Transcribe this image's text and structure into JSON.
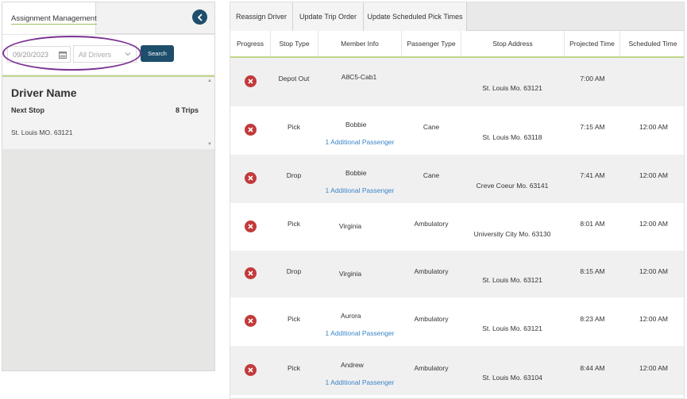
{
  "left_panel": {
    "tab_label": "Assignment Management",
    "filters": {
      "date": "09/20/2023",
      "driver": "All Drivers",
      "search_label": "Search"
    },
    "driver_card": {
      "name": "Driver Name",
      "next_stop_label": "Next Stop",
      "trips": "8 Trips",
      "address": "St. Louis MO. 63121"
    }
  },
  "toolbar": {
    "tabs": [
      "Reassign Driver",
      "Update Trip Order",
      "Update Scheduled Pick Times"
    ]
  },
  "table": {
    "columns": [
      "Progress",
      "Stop Type",
      "Member Info",
      "Passenger Type",
      "Stop Address",
      "Projected Time",
      "Scheduled Time"
    ],
    "rows": [
      {
        "stop_type": "Depot Out",
        "member": "A8C5-Cab1",
        "extra": "",
        "passenger_type": "",
        "address": "St. Louis Mo. 63121",
        "projected": "7:00 AM",
        "scheduled": ""
      },
      {
        "stop_type": "Pick",
        "member": "Bobbie",
        "extra": "1 Additional Passenger",
        "passenger_type": "Cane",
        "address": "St. Louis Mo. 63118",
        "projected": "7:15 AM",
        "scheduled": "12:00 AM"
      },
      {
        "stop_type": "Drop",
        "member": "Bobbie",
        "extra": "1 Additional Passenger",
        "passenger_type": "Cane",
        "address": "Creve Coeur Mo. 63141",
        "projected": "7:41 AM",
        "scheduled": "12:00 AM"
      },
      {
        "stop_type": "Pick",
        "member": "Virginia",
        "extra": "",
        "passenger_type": "Ambulatory",
        "address": "University City Mo. 63130",
        "projected": "8:01 AM",
        "scheduled": "12:00 AM"
      },
      {
        "stop_type": "Drop",
        "member": "Virginia",
        "extra": "",
        "passenger_type": "Ambulatory",
        "address": "St. Louis Mo. 63121",
        "projected": "8:15 AM",
        "scheduled": "12:00 AM"
      },
      {
        "stop_type": "Pick",
        "member": "Aurora",
        "extra": "1 Additional Passenger",
        "passenger_type": "Ambulatory",
        "address": "St. Louis Mo. 63121",
        "projected": "8:23 AM",
        "scheduled": "12:00 AM"
      },
      {
        "stop_type": "Pick",
        "member": "Andrew",
        "extra": "1 Additional Passenger",
        "passenger_type": "Ambulatory",
        "address": "St. Louis Mo. 63104",
        "projected": "8:44 AM",
        "scheduled": "12:00 AM"
      }
    ]
  },
  "colors": {
    "primary": "#1d4e6b",
    "accent_green": "#c2d68a",
    "remove_red": "#c23a3a",
    "link_blue": "#3a85c8",
    "highlight_purple": "#7b3393"
  },
  "icons": {
    "collapse": "chevron-left-icon",
    "calendar": "calendar-icon",
    "dropdown": "chevron-down-icon",
    "remove": "x-circle-icon"
  }
}
